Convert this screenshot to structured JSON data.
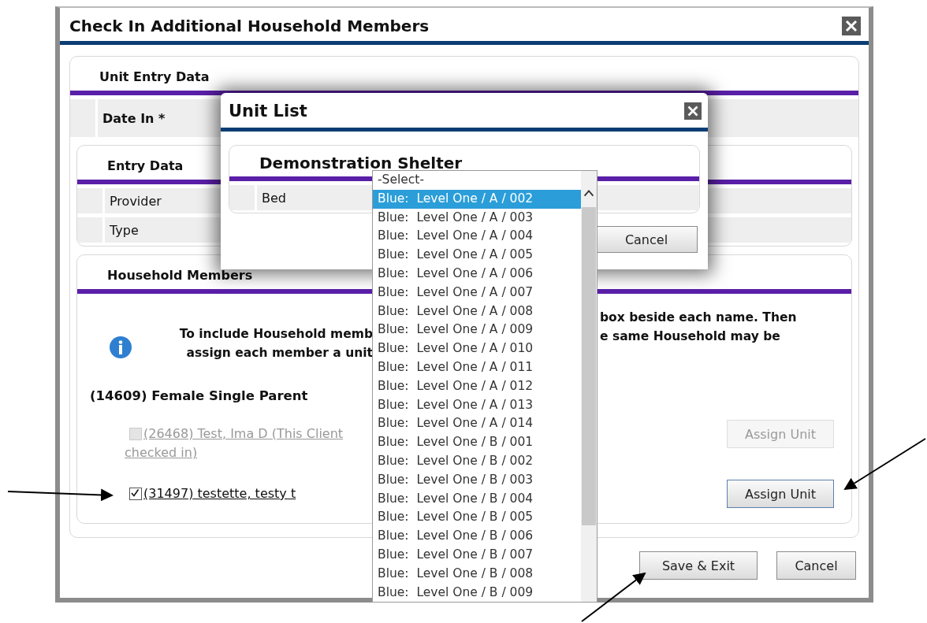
{
  "dialog": {
    "title": "Check In Additional Household Members"
  },
  "unit_entry_data": {
    "title": "Unit Entry Data",
    "fields": [
      {
        "label": "Date In *"
      }
    ]
  },
  "entry_data": {
    "title": "Entry Data",
    "fields": [
      {
        "label": "Provider"
      },
      {
        "label": "Type"
      }
    ]
  },
  "household": {
    "title": "Household Members",
    "instructions_left": [
      "To include Household memb",
      "assign each member a unit"
    ],
    "instructions_right": [
      "box beside each name. Then",
      "e same Household may be"
    ],
    "household_name": "(14609) Female Single Parent",
    "members": [
      {
        "name_lines": [
          "(26468) Test, Ima D (This Client",
          "checked in)"
        ],
        "checked": false,
        "disabled": true,
        "button": "Assign Unit"
      },
      {
        "name_lines": [
          "(31497) testette, testy t"
        ],
        "checked": true,
        "disabled": false,
        "button": "Assign Unit"
      }
    ]
  },
  "buttons": [
    {
      "label": "Save & Exit"
    },
    {
      "label": "Cancel"
    }
  ],
  "unit_list": {
    "title": "Unit List",
    "shelter": "Demonstration Shelter",
    "field": {
      "label": "Bed"
    },
    "cancel": "Cancel"
  },
  "bed_dropdown": {
    "options": [
      {
        "label": "-Select-",
        "selected": false
      },
      {
        "label": "Blue:  Level One / A / 002",
        "selected": true
      },
      {
        "label": "Blue:  Level One / A / 003",
        "selected": false
      },
      {
        "label": "Blue:  Level One / A / 004",
        "selected": false
      },
      {
        "label": "Blue:  Level One / A / 005",
        "selected": false
      },
      {
        "label": "Blue:  Level One / A / 006",
        "selected": false
      },
      {
        "label": "Blue:  Level One / A / 007",
        "selected": false
      },
      {
        "label": "Blue:  Level One / A / 008",
        "selected": false
      },
      {
        "label": "Blue:  Level One / A / 009",
        "selected": false
      },
      {
        "label": "Blue:  Level One / A / 010",
        "selected": false
      },
      {
        "label": "Blue:  Level One / A / 011",
        "selected": false
      },
      {
        "label": "Blue:  Level One / A / 012",
        "selected": false
      },
      {
        "label": "Blue:  Level One / A / 013",
        "selected": false
      },
      {
        "label": "Blue:  Level One / A / 014",
        "selected": false
      },
      {
        "label": "Blue:  Level One / B / 001",
        "selected": false
      },
      {
        "label": "Blue:  Level One / B / 002",
        "selected": false
      },
      {
        "label": "Blue:  Level One / B / 003",
        "selected": false
      },
      {
        "label": "Blue:  Level One / B / 004",
        "selected": false
      },
      {
        "label": "Blue:  Level One / B / 005",
        "selected": false
      },
      {
        "label": "Blue:  Level One / B / 006",
        "selected": false
      },
      {
        "label": "Blue:  Level One / B / 007",
        "selected": false
      },
      {
        "label": "Blue:  Level One / B / 008",
        "selected": false
      },
      {
        "label": "Blue:  Level One / B / 009",
        "selected": false
      }
    ]
  }
}
